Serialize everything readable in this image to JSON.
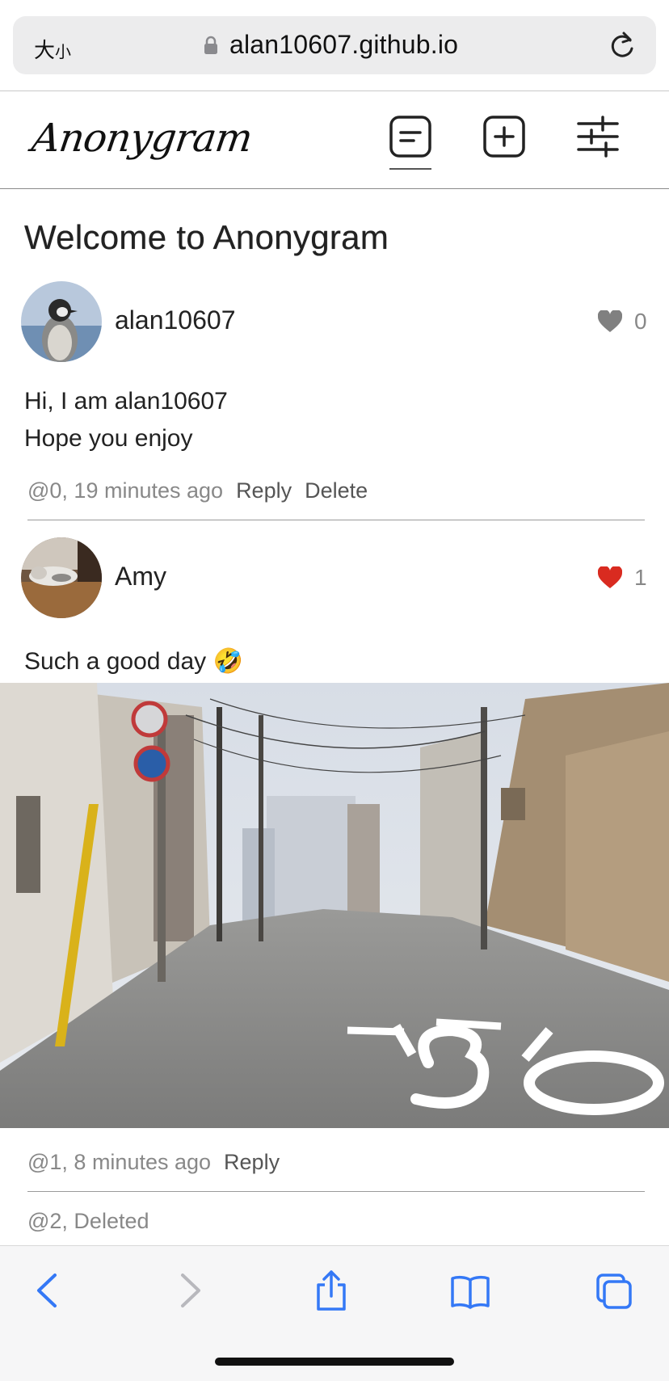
{
  "browser": {
    "text_size_label": "大",
    "text_size_small": "小",
    "url": "alan10607.github.io"
  },
  "app": {
    "logo": "Anonygram"
  },
  "page": {
    "title": "Welcome to Anonygram"
  },
  "posts": [
    {
      "username": "alan10607",
      "likes": "0",
      "liked": false,
      "lines": [
        "Hi, I am alan10607",
        "Hope you enjoy"
      ],
      "meta": "@0, 19 minutes ago",
      "reply_label": "Reply",
      "delete_label": "Delete"
    },
    {
      "username": "Amy",
      "likes": "1",
      "liked": true,
      "lines": [
        "Such a good day 🤣"
      ],
      "meta": "@1, 8 minutes ago",
      "reply_label": "Reply"
    },
    {
      "meta": "@2, Deleted"
    }
  ],
  "colors": {
    "heart_liked": "#d92b20",
    "heart_default": "#808080",
    "toolbar_blue": "#3478f6",
    "toolbar_disabled": "#b8b8bd"
  },
  "icons": {
    "feed": "document-lines-icon",
    "new_post": "plus-square-icon",
    "settings": "sliders-icon",
    "back": "chevron-left-icon",
    "forward": "chevron-right-icon",
    "share": "share-icon",
    "bookmarks": "book-icon",
    "tabs": "tabs-icon"
  }
}
